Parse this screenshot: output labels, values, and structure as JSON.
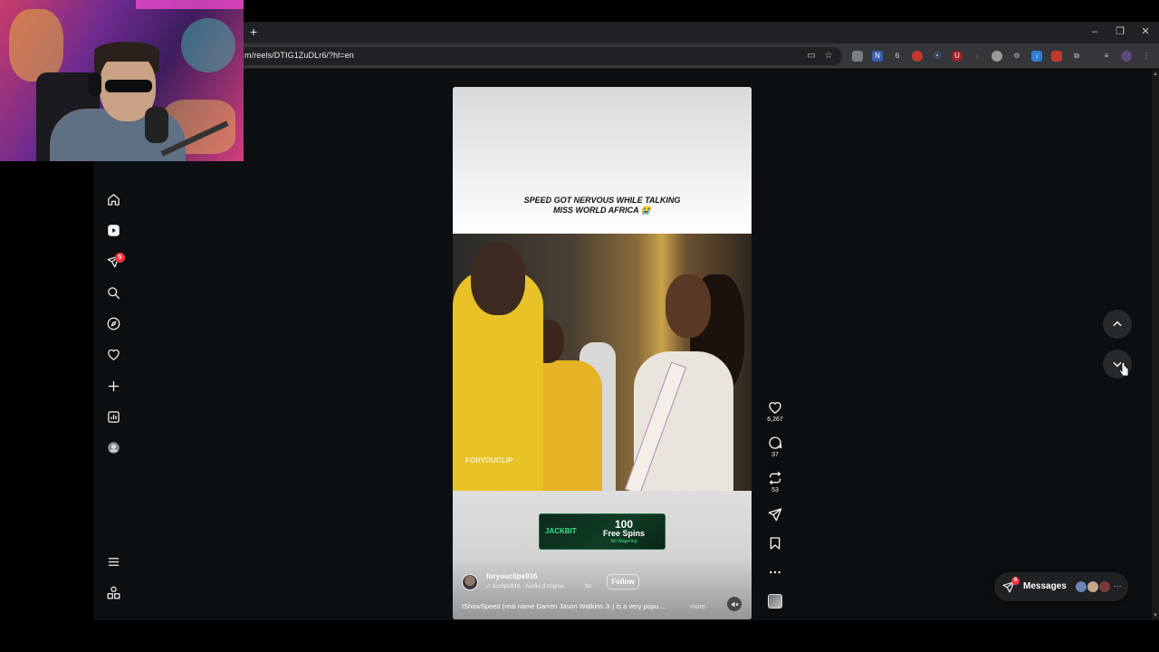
{
  "browser": {
    "new_tab_glyph": "+",
    "url": "m/reels/DTIG1ZuDLr6/?hl=en",
    "window_controls": {
      "minimize": "–",
      "restore": "❐",
      "close": "✕"
    },
    "extension_badge": "6"
  },
  "nav": {
    "items": [
      {
        "name": "home-icon"
      },
      {
        "name": "reels-icon"
      },
      {
        "name": "messages-icon",
        "badge": "5"
      },
      {
        "name": "search-icon"
      },
      {
        "name": "explore-icon"
      },
      {
        "name": "notifications-icon"
      },
      {
        "name": "create-icon"
      },
      {
        "name": "dashboard-icon"
      },
      {
        "name": "profile-icon"
      },
      {
        "name": "more-menu-icon"
      },
      {
        "name": "also-from-meta-icon"
      }
    ]
  },
  "reel": {
    "caption_line1": "SPEED GOT NERVOUS WHILE TALKING",
    "caption_line2": "MISS WORLD AFRICA 😭",
    "watermark": "FORYOUCLIP",
    "ad": {
      "brand": "JACKBIT",
      "number": "100",
      "spins": "Free Spins",
      "sub": "No Wagering"
    },
    "username": "foryouclips916",
    "audio": "♫ ouclips916 · Audio d'origine",
    "audio_for": "for",
    "follow_label": "Follow",
    "description": "IShowSpeed (real name Darren Jason Watkins Jr.) is a very popu ...",
    "more_label": "more"
  },
  "actions": {
    "likes": "6,267",
    "comments": "37",
    "reposts": "53"
  },
  "messages": {
    "label": "Messages",
    "badge": "5",
    "more_glyph": "···"
  },
  "colors": {
    "page_bg": "#0c0f11",
    "accent_badge": "#ff3040",
    "pill_bg": "#1f2224"
  }
}
